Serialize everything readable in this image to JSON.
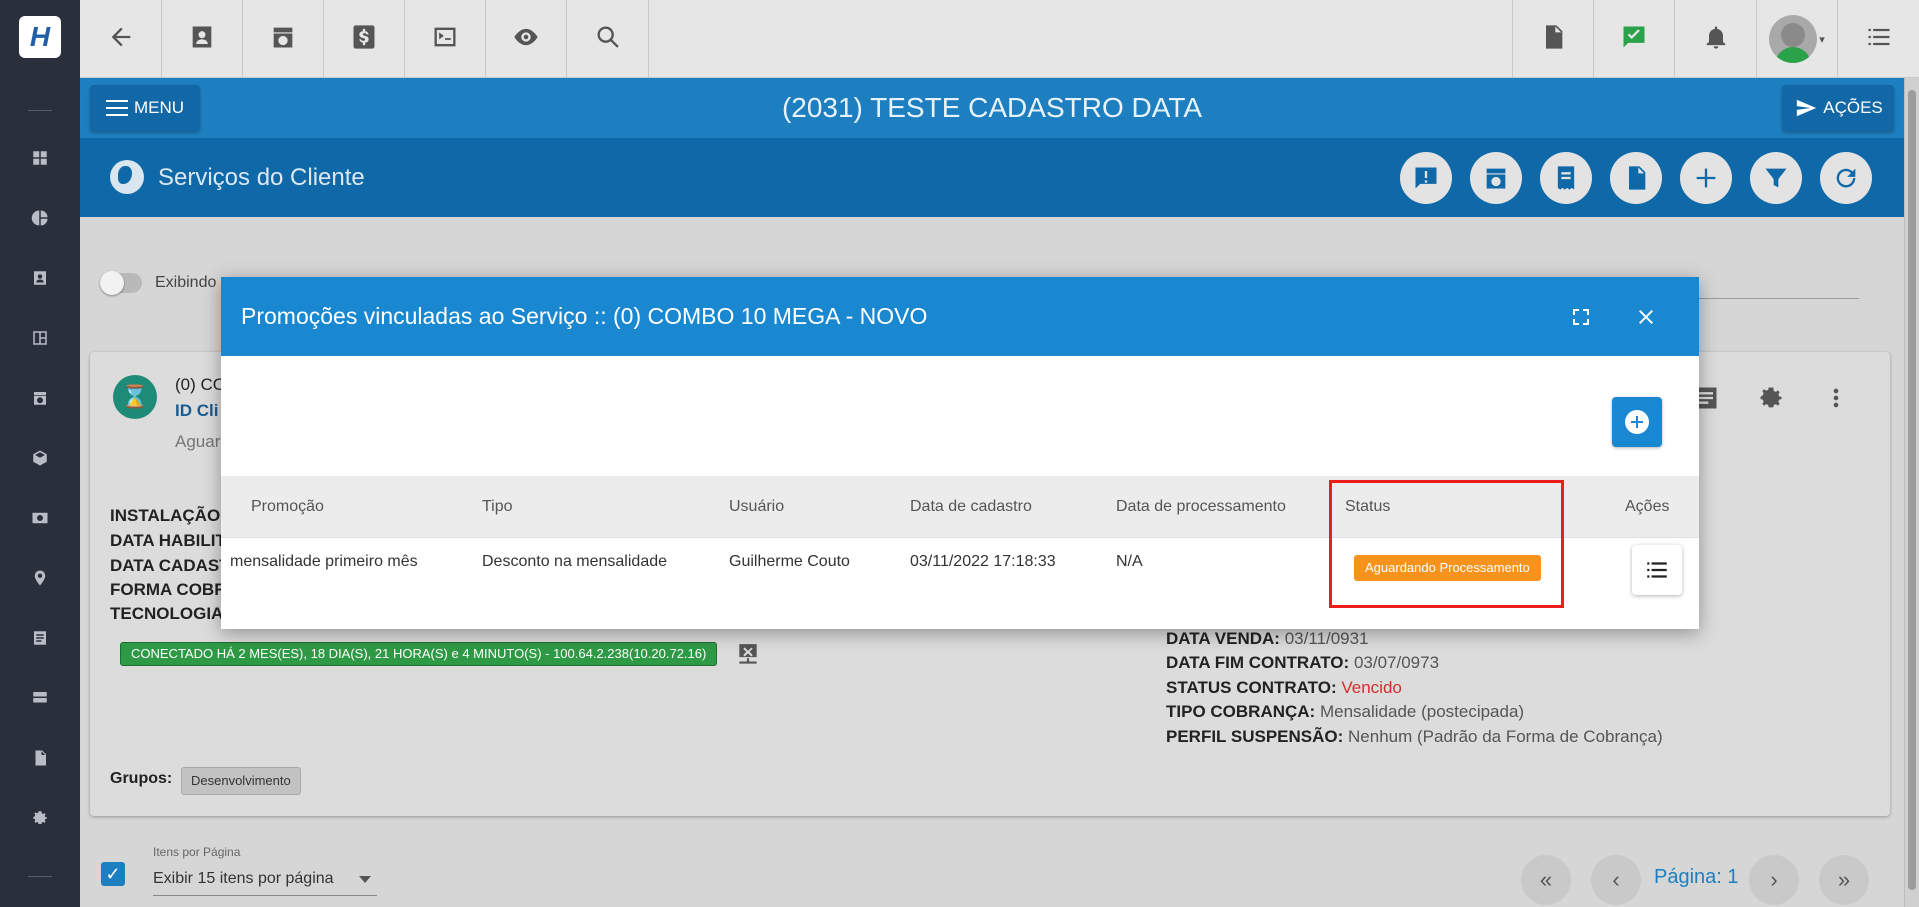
{
  "app": {
    "logo_letter": "H",
    "header_title": "(2031) TESTE CADASTRO DATA",
    "menu_label": "MENU",
    "actions_label": "AÇÕES",
    "section_title": "Serviços do Cliente"
  },
  "colors": {
    "brand_blue": "#1d7fbf",
    "dark_blue": "#0f68a8",
    "modal_header": "#1a88d1",
    "status_orange": "#f7931d",
    "highlight_red": "#ee1c1c",
    "connected_green": "#2f9a45"
  },
  "topbar_icons": [
    "back-arrow-icon",
    "contact-card-icon",
    "calendar-clock-icon",
    "dollar-icon",
    "terminal-icon",
    "eye-icon",
    "search-icon",
    "pdf-icon",
    "check-message-icon",
    "bell-icon",
    "user-avatar",
    "list-icon"
  ],
  "background": {
    "toggle_label": "Exibindo",
    "service_title": "(0) CO",
    "client_id_label": "ID Cli",
    "service_status": "Aguar",
    "labels": [
      "INSTALAÇÃO:",
      "DATA HABILIT",
      "DATA CADAST",
      "FORMA COBRA",
      "TECNOLOGIA"
    ],
    "connected_text": "CONECTADO HÁ 2 MES(ES), 18 DIA(S), 21 HORA(S) e 4 MINUTO(S) - 100.64.2.238(10.20.72.16)",
    "right_info": {
      "data_venda_label": "DATA VENDA:",
      "data_venda_value": "03/11/0931",
      "data_fim_label": "DATA FIM CONTRATO:",
      "data_fim_value": "03/07/0973",
      "status_label": "STATUS CONTRATO:",
      "status_value": "Vencido",
      "tipo_label": "TIPO COBRANÇA:",
      "tipo_value": "Mensalidade (postecipada)",
      "perfil_label": "PERFIL SUSPENSÃO:",
      "perfil_value": "Nenhum (Padrão da Forma de Cobrança)"
    },
    "groups_label": "Grupos:",
    "group_chip": "Desenvolvimento",
    "items_per_page_label": "Itens por Página",
    "items_per_page_value": "Exibir 15 itens por página",
    "page_label": "Página: 1"
  },
  "modal": {
    "title": "Promoções vinculadas ao Serviço :: (0) COMBO 10 MEGA - NOVO",
    "columns": [
      "Promoção",
      "Tipo",
      "Usuário",
      "Data de cadastro",
      "Data de processamento",
      "Status",
      "Ações"
    ],
    "rows": [
      {
        "promocao": "mensalidade primeiro mês",
        "tipo": "Desconto na mensalidade",
        "usuario": "Guilherme Couto",
        "data_cadastro": "03/11/2022 17:18:33",
        "data_processamento": "N/A",
        "status": "Aguardando Processamento"
      }
    ]
  }
}
